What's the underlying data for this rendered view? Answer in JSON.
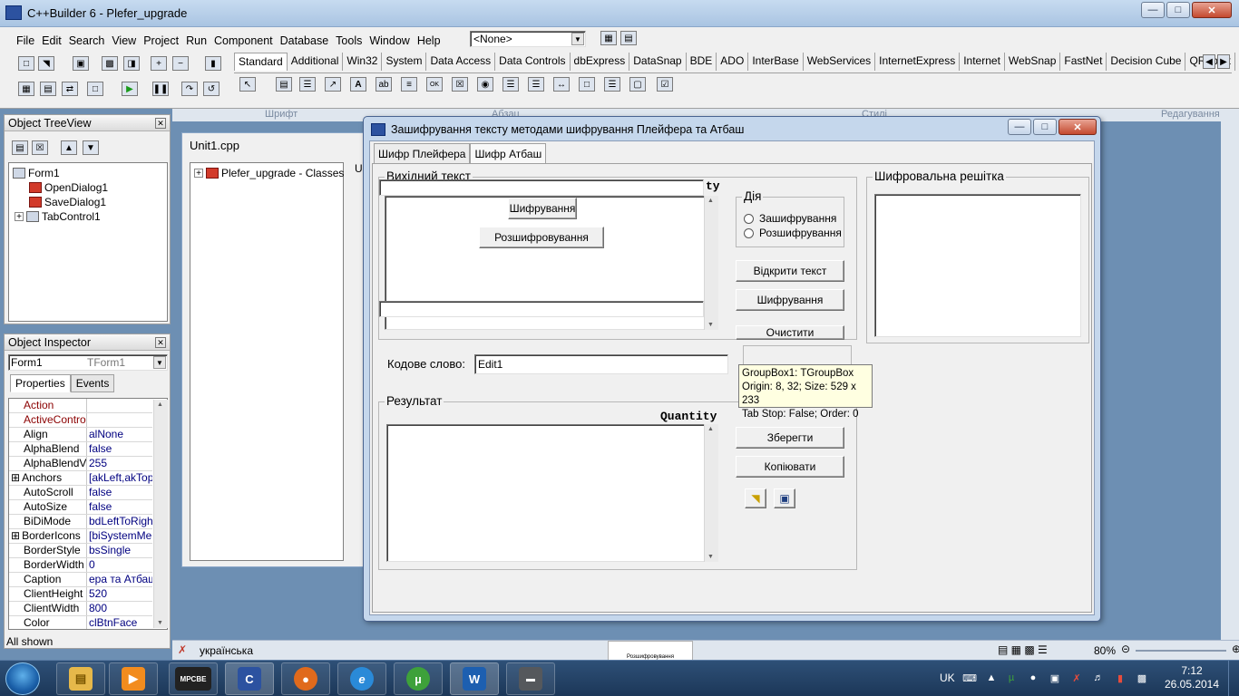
{
  "ide": {
    "title": "C++Builder 6 - Plefer_upgrade",
    "menu": [
      "File",
      "Edit",
      "Search",
      "View",
      "Project",
      "Run",
      "Component",
      "Database",
      "Tools",
      "Window",
      "Help"
    ],
    "target_combo": "<None>",
    "palette_tabs": [
      "Standard",
      "Additional",
      "Win32",
      "System",
      "Data Access",
      "Data Controls",
      "dbExpress",
      "DataSnap",
      "BDE",
      "ADO",
      "InterBase",
      "WebServices",
      "InternetExpress",
      "Internet",
      "WebSnap",
      "FastNet",
      "Decision Cube",
      "QReport"
    ],
    "active_palette_tab": "Standard"
  },
  "word_ribbon": {
    "groups": [
      "Шрифт",
      "Абзац",
      "Стилі",
      "Редагування"
    ]
  },
  "treeview": {
    "title": "Object TreeView",
    "items": [
      {
        "label": "Form1",
        "level": 0
      },
      {
        "label": "OpenDialog1",
        "level": 1
      },
      {
        "label": "SaveDialog1",
        "level": 1
      },
      {
        "label": "TabControl1",
        "level": 1
      }
    ]
  },
  "inspector": {
    "title": "Object Inspector",
    "object_name": "Form1",
    "object_type": "TForm1",
    "tabs": [
      "Properties",
      "Events"
    ],
    "properties": [
      {
        "name": "Action",
        "value": "",
        "highlight": true
      },
      {
        "name": "ActiveControl",
        "value": "",
        "highlight": true
      },
      {
        "name": "Align",
        "value": "alNone"
      },
      {
        "name": "AlphaBlend",
        "value": "false"
      },
      {
        "name": "AlphaBlendValu",
        "value": "255"
      },
      {
        "name": "Anchors",
        "value": "[akLeft,akTop",
        "expand": true
      },
      {
        "name": "AutoScroll",
        "value": "false"
      },
      {
        "name": "AutoSize",
        "value": "false"
      },
      {
        "name": "BiDiMode",
        "value": "bdLeftToRight"
      },
      {
        "name": "BorderIcons",
        "value": "[biSystemMen",
        "expand": true
      },
      {
        "name": "BorderStyle",
        "value": "bsSingle"
      },
      {
        "name": "BorderWidth",
        "value": "0"
      },
      {
        "name": "Caption",
        "value": "ера та Атбаш"
      },
      {
        "name": "ClientHeight",
        "value": "520"
      },
      {
        "name": "ClientWidth",
        "value": "800"
      },
      {
        "name": "Color",
        "value": "clBtnFace"
      }
    ],
    "status": "All shown"
  },
  "code": {
    "tab": "Unit1.cpp",
    "tree_item": "Plefer_upgrade - Classes",
    "side_label": "U"
  },
  "form": {
    "title": "Зашифрування тексту методами шифрування Плейфера та Атбаш",
    "tabs": [
      "Шифр Плейфера",
      "Шифр Атбаш"
    ],
    "active_tab": "Шифр Атбаш",
    "source_group": "Вихідний текст",
    "quantity_label_clipped": "ty",
    "encrypt_inline_button": "Шифрування",
    "decrypt_inline_button": "Розшифровування",
    "action_group": "Дія",
    "radio_encrypt": "Зашифрування",
    "radio_decrypt": "Розшифрування",
    "open_button": "Відкрити текст",
    "cipher_button": "Шифрування",
    "clear_button": "Очистити",
    "code_word_label": "Кодове слово:",
    "code_word_value": "Edit1",
    "result_group": "Результат",
    "quantity_label": "Quantity",
    "save_button": "Зберегти",
    "copy_button": "Копіювати",
    "grid_group": "Шифровальна решітка"
  },
  "tooltip": {
    "line1": "GroupBox1: TGroupBox",
    "line2": "Origin: 8, 32; Size: 529 x 233",
    "line3": "Tab Stop: False; Order: 0"
  },
  "word_status": {
    "language": "українська",
    "zoom": "80%",
    "thumb_label": "Розшифровування"
  },
  "taskbar": {
    "apps": [
      "explorer",
      "media-player",
      "MPC-BE",
      "C++Builder",
      "Firefox",
      "Internet Explorer",
      "uTorrent",
      "Word",
      "game"
    ],
    "mpcbe_label": "MPCBE",
    "lang": "UK",
    "time": "7:12",
    "date": "26.05.2014"
  },
  "colors": {
    "accent": "#2c52a0",
    "tooltip_bg": "#ffffe1",
    "taskbar": "#1c3758"
  }
}
